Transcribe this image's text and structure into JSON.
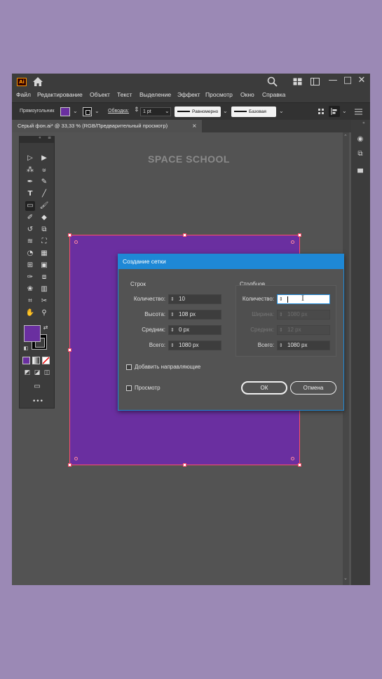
{
  "app": {
    "logo": "Ai",
    "icons": {
      "home": "home-icon",
      "search": "search-icon",
      "arrange": "arrange-documents-icon",
      "panel": "panel-layout-icon"
    },
    "window_controls": {
      "minimize": "—",
      "maximize": "□",
      "close": "✕"
    }
  },
  "menu": [
    "Файл",
    "Редактирование",
    "Объект",
    "Текст",
    "Выделение",
    "Эффект",
    "Просмотр",
    "Окно",
    "Справка"
  ],
  "control_bar": {
    "tool_name": "Прямоугольник",
    "stroke_label": "Обводка:",
    "stroke_weight": "1 pt",
    "profile_1": "Равномерно",
    "profile_2": "Базовая",
    "fill_color": "#6a2fa0"
  },
  "document_tab": {
    "title": "Серый фон.ai* @ 33,33 % (RGB/Предварительный просмотр)",
    "close": "×"
  },
  "canvas": {
    "watermark": "SPACE SCHOOL",
    "artboard_color": "#6a2fa0",
    "selection_color": "#ff4d6a"
  },
  "dialog": {
    "title": "Создание сетки",
    "rows": {
      "heading": "Строк",
      "count_label": "Количество:",
      "count_value": "10",
      "height_label": "Высота:",
      "height_value": "108 px",
      "gutter_label": "Средник:",
      "gutter_value": "0 px",
      "total_label": "Всего:",
      "total_value": "1080 px"
    },
    "columns": {
      "heading": "Столбцов",
      "count_label": "Количество:",
      "count_value": "",
      "width_label": "Ширина:",
      "width_value": "1080 px",
      "gutter_label": "Средник:",
      "gutter_value": "12 px",
      "total_label": "Всего:",
      "total_value": "1080 px"
    },
    "add_guides_label": "Добавить направляющие",
    "preview_label": "Просмотр",
    "ok_label": "ОК",
    "cancel_label": "Отмена",
    "accent": "#1e88d6"
  }
}
